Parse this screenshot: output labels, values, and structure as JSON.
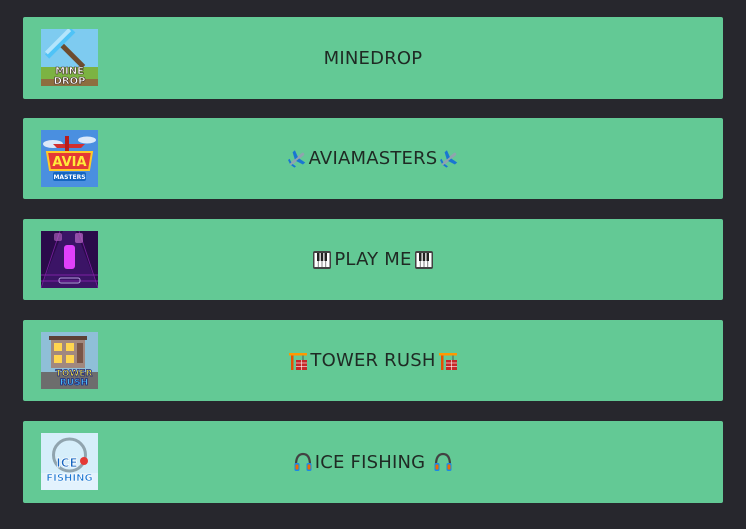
{
  "games": [
    {
      "title": "MINEDROP",
      "thumb_text": [
        "MINE",
        "DROP"
      ],
      "lead_icon": "",
      "trail_icon": ""
    },
    {
      "title": "AVIAMASTERS",
      "thumb_text": [
        "AVIA",
        "MASTERS"
      ],
      "lead_icon": "airplane-icon",
      "trail_icon": "airplane-icon"
    },
    {
      "title": "PLAY ME",
      "thumb_text": [],
      "lead_icon": "piano-icon",
      "trail_icon": "piano-icon"
    },
    {
      "title": "TOWER RUSH",
      "thumb_text": [
        "TOWER",
        "RUSH"
      ],
      "lead_icon": "construction-crane-icon",
      "trail_icon": "construction-crane-icon"
    },
    {
      "title": "ICE FISHING ",
      "thumb_text": [
        "ICE",
        "FISHING"
      ],
      "lead_icon": "headphones-icon",
      "trail_icon": "headphones-icon"
    }
  ],
  "colors": {
    "background": "#27272d",
    "card": "#63c995",
    "text": "#1f2a24"
  }
}
